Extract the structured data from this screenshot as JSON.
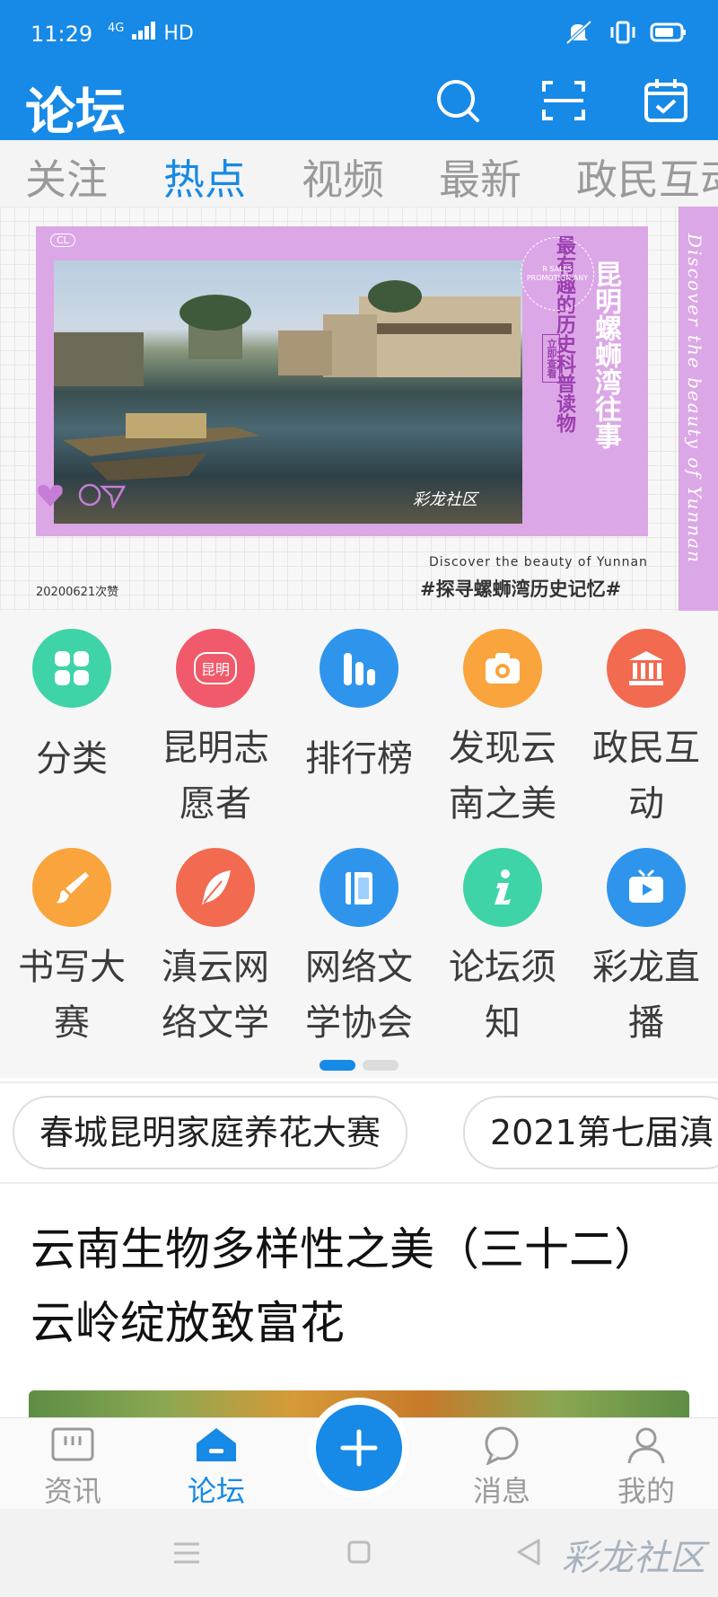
{
  "status_bar": {
    "time": "11:29",
    "network": "4G",
    "hd": "HD"
  },
  "header": {
    "title": "论坛"
  },
  "tabs": [
    "关注",
    "热点",
    "视频",
    "最新",
    "政民互动"
  ],
  "active_tab": "热点",
  "banner": {
    "vertical_title": "昆明螺蛳湾往事",
    "vertical_subtitle": "最有趣的历史科普读物",
    "circle_text": "R SALES PROMOTION ANY",
    "read_now": "立即查看",
    "photo_watermark": "彩龙社区",
    "likes": "20200621次赞",
    "discover": "Discover the beauty of Yunnan",
    "hashtag": "#探寻螺蛳湾历史记忆#",
    "side_text": "Discover the beauty of Yunnan",
    "tag": "CL"
  },
  "grid": {
    "items": [
      {
        "label": "分类",
        "icon": "category-icon",
        "color": "#3fd3a8"
      },
      {
        "label": "昆明志愿者",
        "icon": "volunteer-flower-icon",
        "color": "#f05a6a",
        "badge": "昆明"
      },
      {
        "label": "排行榜",
        "icon": "bar-chart-icon",
        "color": "#2f95ec"
      },
      {
        "label": "发现云南之美",
        "icon": "camera-icon",
        "color": "#f9a43c"
      },
      {
        "label": "政民互动",
        "icon": "government-building-icon",
        "color": "#f26a4f"
      },
      {
        "label": "书写大赛",
        "icon": "brush-icon",
        "color": "#f9a43c"
      },
      {
        "label": "滇云网络文学",
        "icon": "feather-icon",
        "color": "#f26a4f"
      },
      {
        "label": "网络文学协会",
        "icon": "book-icon",
        "color": "#2f95ec"
      },
      {
        "label": "论坛须知",
        "icon": "info-icon",
        "color": "#3fd3a8"
      },
      {
        "label": "彩龙直播",
        "icon": "tv-icon",
        "color": "#2f95ec"
      }
    ],
    "page_count": 2,
    "current_page": 1
  },
  "chips": [
    "春城昆明家庭养花大赛",
    "2021第七届滇"
  ],
  "article": {
    "title": "云南生物多样性之美（三十二）云岭绽放致富花"
  },
  "bottom_nav": {
    "items": [
      {
        "label": "资讯",
        "icon": "news-icon"
      },
      {
        "label": "论坛",
        "icon": "forum-home-icon"
      },
      {
        "label": "消息",
        "icon": "message-icon"
      },
      {
        "label": "我的",
        "icon": "profile-icon"
      }
    ],
    "active": "论坛"
  },
  "watermark": "彩龙社区",
  "colors": {
    "primary": "#1789e6",
    "banner_purple": "#dca7e6",
    "inactive": "#9a9a9a"
  }
}
